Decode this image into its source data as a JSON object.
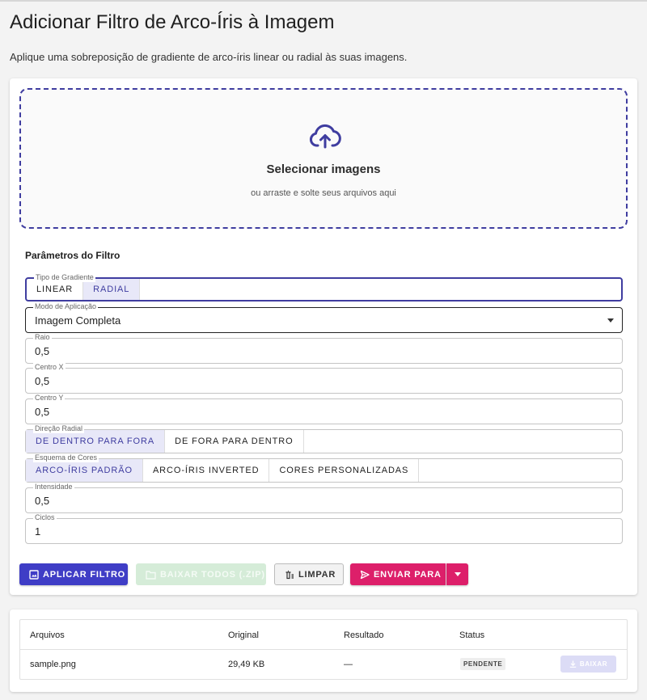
{
  "page": {
    "title": "Adicionar Filtro de Arco-Íris à Imagem",
    "subtitle": "Aplique uma sobreposição de gradiente de arco-íris linear ou radial às suas imagens."
  },
  "dropzone": {
    "title": "Selecionar imagens",
    "hint": "ou arraste e solte seus arquivos aqui",
    "icon": "cloud-upload-icon"
  },
  "params": {
    "title": "Parâmetros do Filtro",
    "gradient_type": {
      "label": "Tipo de Gradiente",
      "options": [
        "LINEAR",
        "RADIAL"
      ],
      "selected": "RADIAL"
    },
    "mode": {
      "label": "Modo de Aplicação",
      "value": "Imagem Completa"
    },
    "radius": {
      "label": "Raio",
      "value": "0,5"
    },
    "center_x": {
      "label": "Centro X",
      "value": "0,5"
    },
    "center_y": {
      "label": "Centro Y",
      "value": "0,5"
    },
    "radial_direction": {
      "label": "Direção Radial",
      "options": [
        "DE DENTRO PARA FORA",
        "DE FORA PARA DENTRO"
      ],
      "selected": "DE DENTRO PARA FORA"
    },
    "color_scheme": {
      "label": "Esquema de Cores",
      "options": [
        "ARCO-ÍRIS PADRÃO",
        "ARCO-ÍRIS INVERTED",
        "CORES PERSONALIZADAS"
      ],
      "selected": "ARCO-ÍRIS PADRÃO"
    },
    "intensity": {
      "label": "Intensidade",
      "value": "0,5"
    },
    "cycles": {
      "label": "Ciclos",
      "value": "1"
    }
  },
  "actions": {
    "apply": "APLICAR FILTRO",
    "download_zip": "BAIXAR TODOS (.ZIP)",
    "clear": "LIMPAR",
    "send": "ENVIAR PARA"
  },
  "files_table": {
    "headers": [
      "Arquivos",
      "Original",
      "Resultado",
      "Status"
    ],
    "rows": [
      {
        "name": "sample.png",
        "original": "29,49 KB",
        "result": "—",
        "status": "PENDENTE",
        "action": "BAIXAR"
      }
    ]
  },
  "colors": {
    "primary": "#3f3dc6",
    "accent": "#dd1f6a",
    "success_disabled": "#d5ecd8",
    "primary_disabled": "#dcdcf6"
  }
}
